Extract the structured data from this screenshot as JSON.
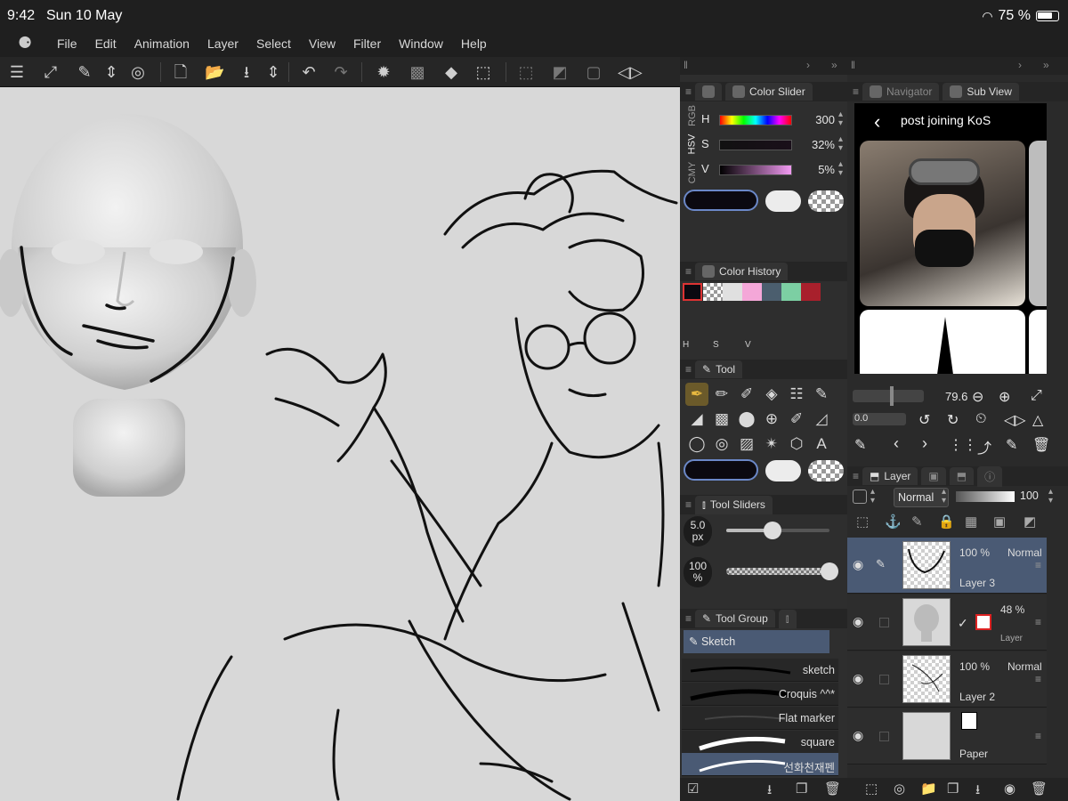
{
  "status": {
    "time": "9:42",
    "date": "Sun 10 May",
    "battery": "75 %"
  },
  "menu": {
    "items": [
      "File",
      "Edit",
      "Animation",
      "Layer",
      "Select",
      "View",
      "Filter",
      "Window",
      "Help"
    ]
  },
  "color_slider": {
    "tab": "Color Slider",
    "modes": [
      "RGB",
      "HSV",
      "CMY"
    ],
    "rows": [
      {
        "label": "H",
        "value": "300"
      },
      {
        "label": "S",
        "value": "32%"
      },
      {
        "label": "V",
        "value": "5%"
      }
    ],
    "main_color": "#0b0910"
  },
  "subview": {
    "tabs": [
      "Navigator",
      "Sub View"
    ],
    "post_title": "post joining KoS"
  },
  "color_history": {
    "tab": "Color History",
    "colors": [
      "#0b0910",
      "checker",
      "#e0e0e0",
      "#f4a7d8",
      "#4b5e6e",
      "#7ccfa3",
      "#a8202c"
    ],
    "footer": [
      "H",
      "S",
      "V"
    ]
  },
  "tool": {
    "tab": "Tool"
  },
  "tool_property": {
    "size": "79.6",
    "opacity": "0.0"
  },
  "tool_sliders": {
    "tab": "Tool Sliders",
    "size_value": "5.0",
    "size_unit": "px",
    "opacity_value": "100",
    "opacity_unit": "%",
    "size_level": 0.45,
    "opacity_level": 1.0
  },
  "tool_group": {
    "tab": "Tool Group",
    "selected": "Sketch"
  },
  "brushes": [
    "sketch",
    "Croquis ^^*",
    "Flat marker",
    "square",
    "선화천재펜"
  ],
  "layer_panel": {
    "tab": "Layer",
    "blend_mode": "Normal",
    "opacity": "100"
  },
  "layers": [
    {
      "opacity": "100 %",
      "mode": "Normal",
      "name": "Layer 3"
    },
    {
      "opacity": "48 %",
      "mode": "",
      "name": "Layer"
    },
    {
      "opacity": "100 %",
      "mode": "Normal",
      "name": "Layer 2"
    },
    {
      "opacity": "",
      "mode": "",
      "name": "Paper"
    }
  ]
}
